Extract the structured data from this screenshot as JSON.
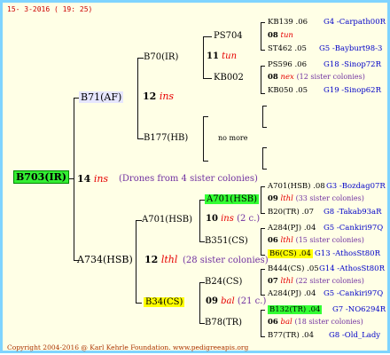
{
  "header": {
    "date": "15-  3-2016 ( 19: 25)"
  },
  "root": {
    "name": "B703(IR)",
    "gen": "14",
    "line": "ins",
    "note": "(Drones from 4 sister colonies)"
  },
  "top": {
    "node": "B71(AF)",
    "gen": "12",
    "line": "ins",
    "a": {
      "node": "B70(IR)",
      "gen": "11",
      "line": "tun",
      "a": {
        "node": "PS704",
        "r1": {
          "name": "KB139",
          "yr": ".06",
          "code": "G4 -Carpath00R"
        },
        "r2": {
          "gen": "08",
          "line": "tun"
        },
        "r3": {
          "name": "ST462",
          "yr": ".05",
          "code": "G5 -Bayburt98-3"
        }
      },
      "b": {
        "node": "KB002",
        "r1": {
          "name": "PS596",
          "yr": ".06",
          "code": "G18 -Sinop72R"
        },
        "r2": {
          "gen": "08",
          "line": "nex",
          "note": "(12 sister colonies)"
        },
        "r3": {
          "name": "KB050",
          "yr": ".05",
          "code": "G19 -Sinop62R"
        }
      }
    },
    "b": {
      "node": "B177(HB)",
      "more": "no more"
    }
  },
  "bottom": {
    "node": "A734(HSB)",
    "gen": "12",
    "line": "lthl",
    "note": "(28 sister colonies)",
    "a": {
      "node": "A701(HSB)",
      "gen": "10",
      "line": "ins",
      "note": "(2 c.)",
      "a": {
        "node": "A701(HSB)",
        "r1": {
          "name": "A701(HSB)",
          "yr": ".08",
          "code": "G3 -Bozdag07R"
        },
        "r2": {
          "gen": "09",
          "line": "lthl",
          "note": "(33 sister colonies)"
        },
        "r3": {
          "name": "B20(TR)",
          "yr": ".07",
          "code": "G8 -Takab93aR"
        }
      },
      "b": {
        "node": "B351(CS)",
        "r1": {
          "name": "A284(PJ)",
          "yr": ".04",
          "code": "G5 -Cankiri97Q"
        },
        "r2": {
          "gen": "06",
          "line": "lthl",
          "note": "(15 sister colonies)"
        },
        "r3": {
          "name": "B6(CS)",
          "yr": ".04",
          "code": "G13 -AthosSt80R"
        }
      }
    },
    "b": {
      "node": "B34(CS)",
      "gen": "09",
      "line": "bal",
      "note": "(21 c.)",
      "a": {
        "node": "B24(CS)",
        "r1": {
          "name": "B444(CS)",
          "yr": ".05",
          "code": "G14 -AthosSt80R"
        },
        "r2": {
          "gen": "07",
          "line": "lthl",
          "note": "(22 sister colonies)"
        },
        "r3": {
          "name": "A284(PJ)",
          "yr": ".04",
          "code": "G5 -Cankiri97Q"
        }
      },
      "b": {
        "node": "B78(TR)",
        "r1": {
          "name": "B132(TR)",
          "yr": ".04",
          "code": "G7 -NO6294R"
        },
        "r2": {
          "gen": "06",
          "line": "bal",
          "note": "(18 sister colonies)"
        },
        "r3": {
          "name": "B77(TR)",
          "yr": ".04",
          "code": "G8 -Old_Lady"
        }
      }
    }
  },
  "footer": {
    "copyright": "Copyright 2004-2016 @ Karl Kehrle Foundation.",
    "url": "www.pedigreeapis.org"
  }
}
